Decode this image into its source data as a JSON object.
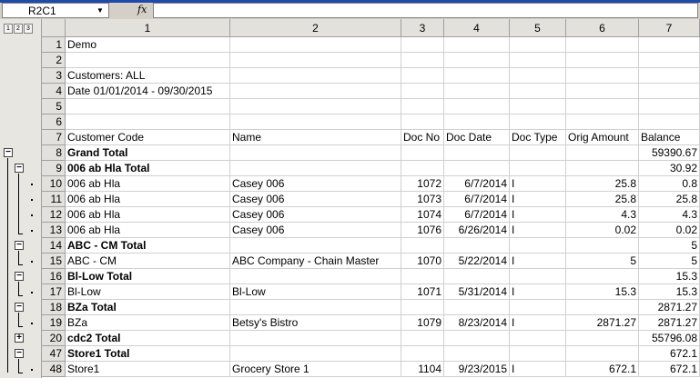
{
  "formula_bar": {
    "name_box": "R2C1",
    "fx_label": "fx",
    "formula": ""
  },
  "outline_levels": [
    "1",
    "2",
    "3"
  ],
  "columns": [
    "1",
    "2",
    "3",
    "4",
    "5",
    "6",
    "7"
  ],
  "rows": [
    {
      "num": "1",
      "cells": [
        "Demo",
        "",
        "",
        "",
        "",
        "",
        ""
      ],
      "total": false
    },
    {
      "num": "2",
      "cells": [
        "",
        "",
        "",
        "",
        "",
        "",
        ""
      ],
      "total": false
    },
    {
      "num": "3",
      "cells": [
        "Customers: ALL",
        "",
        "",
        "",
        "",
        "",
        ""
      ],
      "total": false
    },
    {
      "num": "4",
      "cells": [
        "Date 01/01/2014 - 09/30/2015",
        "",
        "",
        "",
        "",
        "",
        ""
      ],
      "total": false
    },
    {
      "num": "5",
      "cells": [
        "",
        "",
        "",
        "",
        "",
        "",
        ""
      ],
      "total": false
    },
    {
      "num": "6",
      "cells": [
        "",
        "",
        "",
        "",
        "",
        "",
        ""
      ],
      "total": false
    },
    {
      "num": "7",
      "cells": [
        "Customer Code",
        "Name",
        "Doc No",
        "Doc Date",
        "Doc Type",
        "Orig Amount",
        "Balance"
      ],
      "total": false
    },
    {
      "num": "8",
      "cells": [
        "Grand Total",
        "",
        "",
        "",
        "",
        "",
        "59390.67"
      ],
      "total": true
    },
    {
      "num": "9",
      "cells": [
        "006 ab Hla Total",
        "",
        "",
        "",
        "",
        "",
        "30.92"
      ],
      "total": true
    },
    {
      "num": "10",
      "cells": [
        "006 ab Hla",
        "Casey 006",
        "1072",
        "6/7/2014",
        "I",
        "25.8",
        "0.8"
      ],
      "total": false
    },
    {
      "num": "11",
      "cells": [
        "006 ab Hla",
        "Casey 006",
        "1073",
        "6/7/2014",
        "I",
        "25.8",
        "25.8"
      ],
      "total": false
    },
    {
      "num": "12",
      "cells": [
        "006 ab Hla",
        "Casey 006",
        "1074",
        "6/7/2014",
        "I",
        "4.3",
        "4.3"
      ],
      "total": false
    },
    {
      "num": "13",
      "cells": [
        "006 ab Hla",
        "Casey 006",
        "1076",
        "6/26/2014",
        "I",
        "0.02",
        "0.02"
      ],
      "total": false
    },
    {
      "num": "14",
      "cells": [
        "ABC - CM Total",
        "",
        "",
        "",
        "",
        "",
        "5"
      ],
      "total": true
    },
    {
      "num": "15",
      "cells": [
        "ABC - CM",
        "ABC Company - Chain Master",
        "1070",
        "5/22/2014",
        "I",
        "5",
        "5"
      ],
      "total": false
    },
    {
      "num": "16",
      "cells": [
        "Bl-Low Total",
        "",
        "",
        "",
        "",
        "",
        "15.3"
      ],
      "total": true
    },
    {
      "num": "17",
      "cells": [
        "Bl-Low",
        "Bl-Low",
        "1071",
        "5/31/2014",
        "I",
        "15.3",
        "15.3"
      ],
      "total": false
    },
    {
      "num": "18",
      "cells": [
        "BZa Total",
        "",
        "",
        "",
        "",
        "",
        "2871.27"
      ],
      "total": true
    },
    {
      "num": "19",
      "cells": [
        "BZa",
        "Betsy's Bistro",
        "1079",
        "8/23/2014",
        "I",
        "2871.27",
        "2871.27"
      ],
      "total": false
    },
    {
      "num": "20",
      "cells": [
        "cdc2 Total",
        "",
        "",
        "",
        "",
        "",
        "55796.08"
      ],
      "total": true
    },
    {
      "num": "47",
      "cells": [
        "Store1 Total",
        "",
        "",
        "",
        "",
        "",
        "672.1"
      ],
      "total": true
    },
    {
      "num": "48",
      "cells": [
        "Store1",
        "Grocery Store 1",
        "1104",
        "9/23/2015",
        "I",
        "672.1",
        "672.1"
      ],
      "total": false
    }
  ],
  "outline_buttons": {
    "collapse": "−",
    "expand": "+",
    "dot": "·"
  }
}
